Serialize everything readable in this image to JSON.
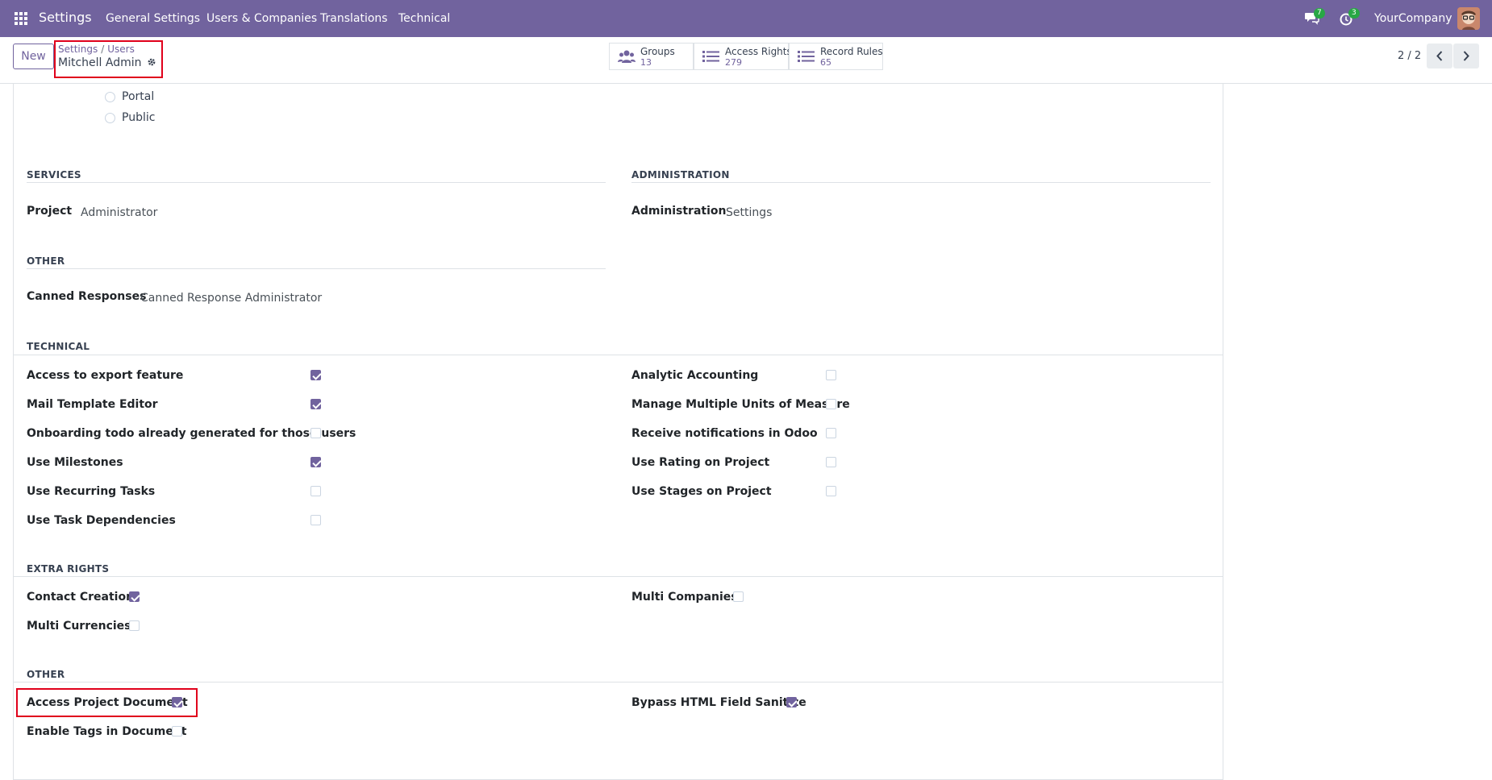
{
  "navbar": {
    "brand": "Settings",
    "menu": [
      "General Settings",
      "Users & Companies",
      "Translations",
      "Technical"
    ],
    "chat_badge": "7",
    "activity_badge": "3",
    "company": "YourCompany"
  },
  "control": {
    "new_label": "New",
    "breadcrumb": [
      "Settings",
      "Users"
    ],
    "record": "Mitchell Admin",
    "pager": "2 / 2",
    "smart_buttons": [
      {
        "label": "Groups",
        "value": "13"
      },
      {
        "label": "Access Rights",
        "value": "279"
      },
      {
        "label": "Record Rules",
        "value": "65"
      }
    ]
  },
  "user_types": [
    "Portal",
    "Public"
  ],
  "sections": {
    "services": {
      "title": "SERVICES",
      "label": "Project",
      "value": "Administrator"
    },
    "administration": {
      "title": "ADMINISTRATION",
      "label": "Administration",
      "value": "Settings"
    },
    "other1": {
      "title": "OTHER",
      "label": "Canned Responses",
      "value": "Canned Response Administrator"
    },
    "technical": {
      "title": "TECHNICAL",
      "left": [
        {
          "label": "Access to export feature",
          "checked": true
        },
        {
          "label": "Mail Template Editor",
          "checked": true
        },
        {
          "label": "Onboarding todo already generated for those users",
          "checked": false
        },
        {
          "label": "Use Milestones",
          "checked": true
        },
        {
          "label": "Use Recurring Tasks",
          "checked": false
        },
        {
          "label": "Use Task Dependencies",
          "checked": false
        }
      ],
      "right": [
        {
          "label": "Analytic Accounting",
          "checked": false
        },
        {
          "label": "Manage Multiple Units of Measure",
          "checked": false
        },
        {
          "label": "Receive notifications in Odoo",
          "checked": false
        },
        {
          "label": "Use Rating on Project",
          "checked": false
        },
        {
          "label": "Use Stages on Project",
          "checked": false
        }
      ]
    },
    "extra_rights": {
      "title": "EXTRA RIGHTS",
      "left": [
        {
          "label": "Contact Creation",
          "checked": true
        },
        {
          "label": "Multi Currencies",
          "checked": false
        }
      ],
      "right": [
        {
          "label": "Multi Companies",
          "checked": false
        }
      ]
    },
    "other2": {
      "title": "OTHER",
      "left": [
        {
          "label": "Access Project Document",
          "checked": true
        },
        {
          "label": "Enable Tags in Document",
          "checked": false
        }
      ],
      "right": [
        {
          "label": "Bypass HTML Field Sanitize",
          "checked": true
        }
      ]
    }
  },
  "colors": {
    "brand": "#71639e",
    "highlight": "#e0001b"
  }
}
